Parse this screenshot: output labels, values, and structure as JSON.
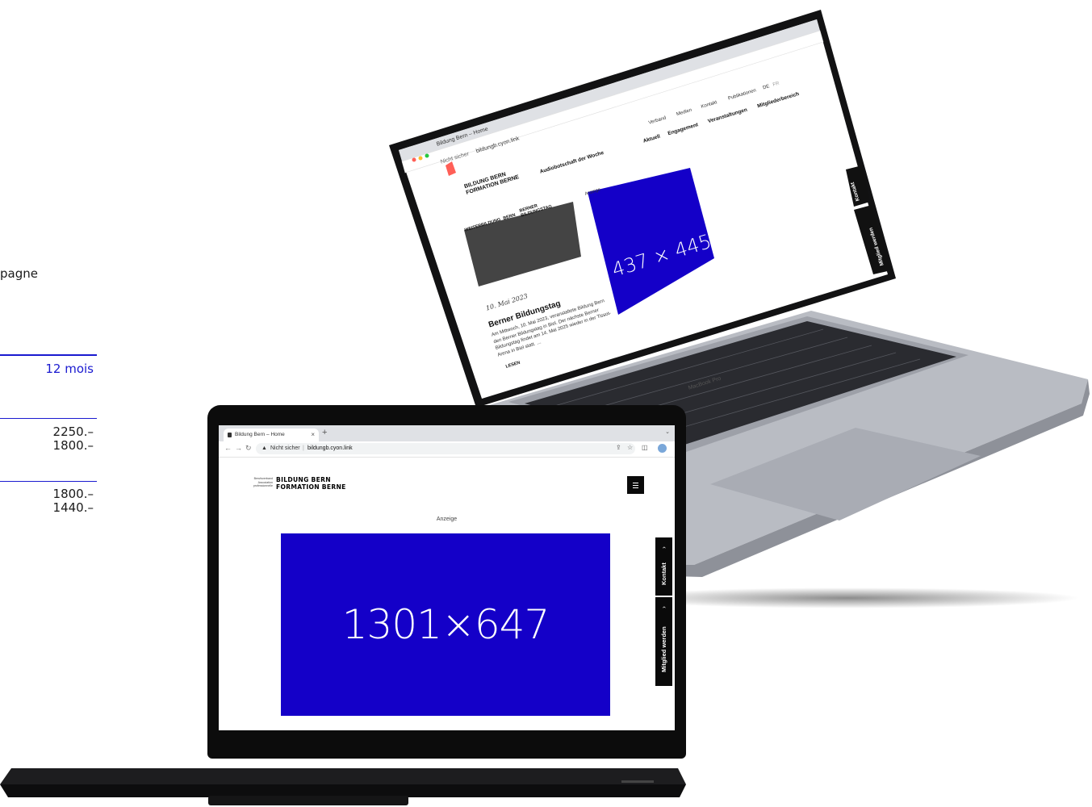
{
  "price_panel": {
    "fragment_text": "pagne",
    "header_period": "12 mois",
    "group1": [
      "2250.–",
      "1800.–"
    ],
    "group2": [
      "1800.–",
      "1440.–"
    ],
    "accent_color": "#1a1ad0"
  },
  "back_laptop": {
    "brand": "MacBook Pro",
    "browser": {
      "tab_title": "Bildung Bern – Home",
      "security_label": "Nicht sicher",
      "url": "bildungb.cyon.link"
    },
    "site": {
      "logo_small": "Berufsverband Association professionnelle",
      "logo_line1": "BILDUNG BERN",
      "logo_line2": "FORMATION BERNE",
      "audio_label": "Audiobotschaft der Woche",
      "top_nav": [
        "Verband",
        "Medien",
        "Kontakt",
        "Publikationen"
      ],
      "lang": [
        "DE",
        "FR"
      ],
      "main_nav": [
        "Aktuell",
        "Engagement",
        "Veranstaltungen",
        "Mitgliederbereich"
      ],
      "tags": [
        "WEITERBILDUNG",
        "BERN",
        "BERNER BILDUNGSTAG"
      ],
      "date": "10. Mai 2023",
      "article_title": "Berner Bildungstag",
      "article_text": "Am Mittwoch, 10. Mai 2023, veranstaltete Bildung Bern den Berner Bildungstag in Biel. Der nächste Berner Bildungstag findet am 14. Mai 2025 wieder in der Tissot-Arena in Biel statt. …",
      "read_more": "LESEN",
      "ad_label": "Anzeige",
      "ad_text": "437 × 445",
      "side_kontakt": "Kontakt",
      "side_member": "Mitglied werden"
    }
  },
  "front_laptop": {
    "browser": {
      "tab_title": "Bildung Bern – Home",
      "security_label": "Nicht sicher",
      "url": "bildungb.cyon.link"
    },
    "site": {
      "logo_small_1": "Berufsverband",
      "logo_small_2": "Association",
      "logo_small_3": "professionnelle",
      "logo_line1": "BILDUNG BERN",
      "logo_line2": "FORMATION BERNE",
      "ad_label": "Anzeige",
      "ad_text": "1301×647",
      "ad_color": "#1400c8",
      "side_kontakt": "Kontakt",
      "side_member": "Mitglied werden"
    }
  }
}
